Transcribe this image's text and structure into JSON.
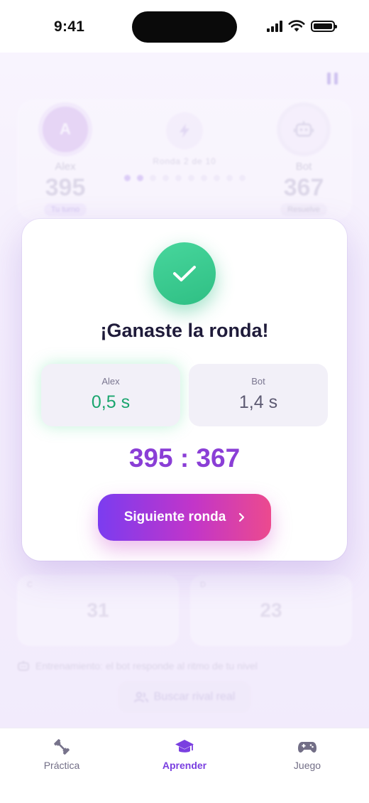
{
  "status_bar": {
    "time": "9:41"
  },
  "game": {
    "player": {
      "initial": "A",
      "name": "Alex",
      "score": "395",
      "tag": "Tu turno"
    },
    "opponent": {
      "name": "Bot",
      "score": "367",
      "tag": "Resuelve"
    },
    "round_label": "Ronda 2 de 10",
    "rounds_total": 10,
    "rounds_done": 2,
    "options": [
      {
        "index": "C",
        "value": "31"
      },
      {
        "index": "D",
        "value": "23"
      }
    ],
    "hint": "Entrenamiento: el bot responde al ritmo de tu nivel",
    "find_rival_label": "Buscar rival real"
  },
  "modal": {
    "title": "¡Ganaste la ronda!",
    "player_time": {
      "name": "Alex",
      "value": "0,5 s"
    },
    "opponent_time": {
      "name": "Bot",
      "value": "1,4 s"
    },
    "score": "395 : 367",
    "next_button": "Siguiente ronda"
  },
  "tabbar": {
    "items": [
      {
        "label": "Práctica",
        "icon": "dumbbell-icon"
      },
      {
        "label": "Aprender",
        "icon": "graduation-cap-icon",
        "active": true
      },
      {
        "label": "Juego",
        "icon": "gamepad-icon"
      }
    ]
  },
  "colors": {
    "accent": "#7a3fe0",
    "success": "#2fbf84",
    "pink": "#ec4a8e"
  }
}
